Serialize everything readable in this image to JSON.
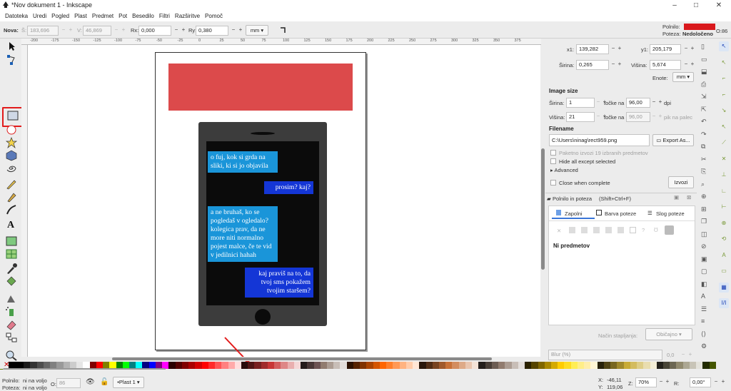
{
  "window": {
    "title": "*Nov dokument 1 - Inkscape",
    "minimize": "–",
    "maximize": "□",
    "close": "✕"
  },
  "menu": [
    "Datoteka",
    "Uredi",
    "Pogled",
    "Plast",
    "Predmet",
    "Pot",
    "Besedilo",
    "Filtri",
    "Razširitve",
    "Pomoč"
  ],
  "toolbar": {
    "label": "Nova:",
    "w_label": "Š:",
    "w_value": "183,696",
    "h_label": "V:",
    "h_value": "46,869",
    "rx_label": "Rx:",
    "rx_value": "0,000",
    "ry_label": "Ry:",
    "ry_value": "0,380",
    "unit": "mm",
    "fill_label": "Polnilo:",
    "stroke_label": "Poteza:",
    "stroke_value": "Nedoločeno",
    "opacity_label": "O:",
    "opacity_value": "86"
  },
  "ruler_numbers": [
    "-200",
    "-175",
    "-150",
    "-125",
    "-100",
    "-75",
    "-50",
    "-25",
    "0",
    "25",
    "50",
    "75",
    "100",
    "125",
    "150",
    "175",
    "200",
    "225",
    "250",
    "275",
    "300",
    "325",
    "350",
    "375"
  ],
  "export": {
    "x_label": "x1:",
    "x_value": "139,282",
    "y_label": "y1:",
    "y_value": "205,179",
    "w_label": "Širina:",
    "w_value": "0,265",
    "h_label": "Višina:",
    "h_value": "5,674",
    "units_label": "Enote:",
    "units_value": "mm",
    "image_size_heading": "Image size",
    "img_w_label": "Širina:",
    "img_w_value": "1",
    "dpi_label1": "točke na",
    "dpi_value": "96,00",
    "dpi_unit": "dpi",
    "img_h_label": "Višina:",
    "img_h_value": "21",
    "dpi_label2": "točke na",
    "dpi_value2": "96,00",
    "dpi_unit2": "pik na palec",
    "filename_heading": "Filename",
    "filename_value": "C:\\Users\\ninag\\rect959.png",
    "export_as": "Export As...",
    "batch_label": "Paketno izvozi 19 izbranih predmetov",
    "hide_label": "Hide all except selected",
    "advanced_label": "Advanced",
    "close_label": "Close when complete",
    "export_button": "Izvozi"
  },
  "fill_stroke": {
    "title": "Polnilo in poteza",
    "shortcut": "(Shift+Ctrl+F)",
    "tabs": [
      "Zapolni",
      "Barva poteze",
      "Slog poteze"
    ],
    "no_objects": "Ni predmetov",
    "blend_label": "Način stapljanja:",
    "blend_value": "Običajno",
    "blur_label": "Blur (%)",
    "blur_value": "0,0"
  },
  "canvas": {
    "red_rect_color": "#dc4a4b",
    "phone_color": "#3c3c3c",
    "screen_color": "#0b0b0b",
    "light_blue": "#1a95d9",
    "dark_blue": "#1436d6",
    "messages": [
      {
        "text": "o fuj, kok si grda na sliki, ki si jo objavila",
        "side": "left"
      },
      {
        "text": "prosim? kaj?",
        "side": "right"
      },
      {
        "text": "a ne bruhaš, ko se pogledaš v ogledalo? kolegica prav, da ne more niti normalno pojest malce, če te vid v jedilnici hahah",
        "side": "left"
      },
      {
        "text": "kaj praviš na to, da tvoj sms pokažem tvojim staršem?",
        "side": "right"
      }
    ]
  },
  "status": {
    "fill_label": "Polnilo:",
    "fill_value": "ni na voljo",
    "stroke_label": "Poteza:",
    "stroke_value": "ni na voljo",
    "o_label": "O:",
    "o_value": "86",
    "layer": "•Plast 1",
    "x_label": "X:",
    "x_value": "-46,11",
    "y_label": "Y:",
    "y_value": "119,06",
    "z_label": "Z:",
    "zoom": "70%",
    "r_label": "R:",
    "rotation": "0,00°"
  }
}
